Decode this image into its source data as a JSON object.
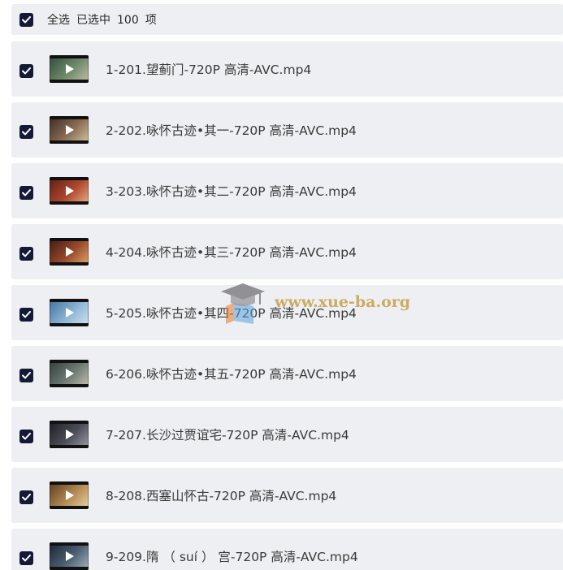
{
  "header": {
    "select_all_label": "全选",
    "selected_prefix": "已选中",
    "selected_count": "100",
    "selected_suffix": "项",
    "checked": true
  },
  "files": [
    {
      "name": "1-201.望蓟门-720P 高清-AVC.mp4",
      "checked": true,
      "thumb_colors": [
        "#2f4a3a",
        "#6f8a6a",
        "#c7c0a8"
      ]
    },
    {
      "name": "2-202.咏怀古迹•其一-720P 高清-AVC.mp4",
      "checked": true,
      "thumb_colors": [
        "#3b2a20",
        "#8a6d55",
        "#d8c7a3"
      ]
    },
    {
      "name": "3-203.咏怀古迹•其二-720P 高清-AVC.mp4",
      "checked": true,
      "thumb_colors": [
        "#5a1e14",
        "#b0472e",
        "#e9b48a"
      ]
    },
    {
      "name": "4-204.咏怀古迹•其三-720P 高清-AVC.mp4",
      "checked": true,
      "thumb_colors": [
        "#3a1a12",
        "#9a4a2a",
        "#e2a86c"
      ]
    },
    {
      "name": "5-205.咏怀古迹•其四-720P 高清-AVC.mp4",
      "checked": true,
      "thumb_colors": [
        "#3e6f9a",
        "#8fb6d6",
        "#d5e4ee"
      ]
    },
    {
      "name": "6-206.咏怀古迹•其五-720P 高清-AVC.mp4",
      "checked": true,
      "thumb_colors": [
        "#2e3b3a",
        "#6d7a74",
        "#c9c2ae"
      ]
    },
    {
      "name": "7-207.长沙过贾谊宅-720P 高清-AVC.mp4",
      "checked": true,
      "thumb_colors": [
        "#1d1d22",
        "#4b4e58",
        "#9c9fa8"
      ]
    },
    {
      "name": "8-208.西塞山怀古-720P 高清-AVC.mp4",
      "checked": true,
      "thumb_colors": [
        "#5a3a1e",
        "#b58a54",
        "#ead6a8"
      ]
    },
    {
      "name": "9-209.隋 （ suí ） 宫-720P 高清-AVC.mp4",
      "checked": true,
      "thumb_colors": [
        "#1c2430",
        "#4d5f73",
        "#a8b6c4"
      ]
    }
  ],
  "watermark": {
    "text": "www.xue-ba.org"
  }
}
